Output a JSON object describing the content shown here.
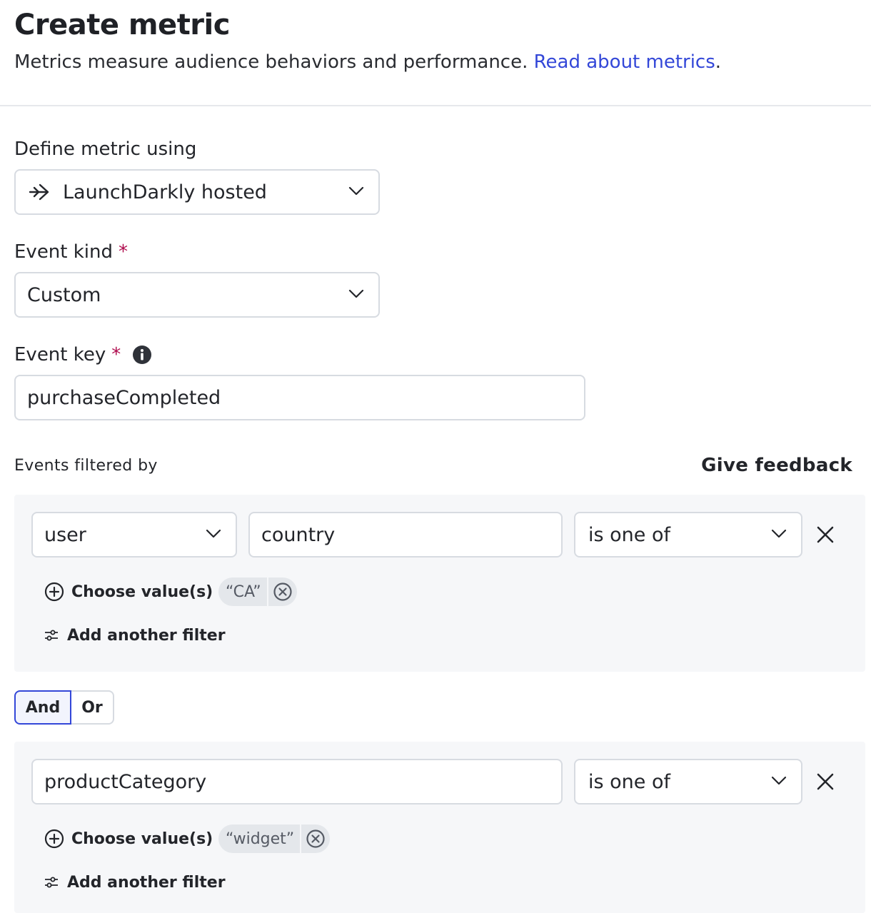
{
  "header": {
    "title": "Create metric",
    "subtitle": "Metrics measure audience behaviors and performance.",
    "link": "Read about metrics",
    "link_suffix": "."
  },
  "define": {
    "label": "Define metric using",
    "value": "LaunchDarkly hosted",
    "icon": "arrow-right-icon"
  },
  "event_kind": {
    "label": "Event kind",
    "required_mark": "*",
    "value": "Custom"
  },
  "event_key": {
    "label": "Event key",
    "required_mark": "*",
    "value": "purchaseCompleted",
    "icon": "info-icon"
  },
  "filters": {
    "label": "Events filtered by",
    "feedback": "Give feedback",
    "choose_label": "Choose value(s)",
    "add_filter_label": "Add another filter",
    "groups": [
      {
        "context": "user",
        "attribute": "country",
        "operator": "is one of",
        "values": [
          "“CA”"
        ]
      },
      {
        "attribute": "productCategory",
        "operator": "is one of",
        "values": [
          "“widget”"
        ]
      }
    ],
    "logic": {
      "options": [
        "And",
        "Or"
      ],
      "selected": "And"
    }
  },
  "colors": {
    "accent": "#3347d8",
    "required": "#b00d4e",
    "panel": "#f6f7f9",
    "border": "#d7dbe1"
  }
}
